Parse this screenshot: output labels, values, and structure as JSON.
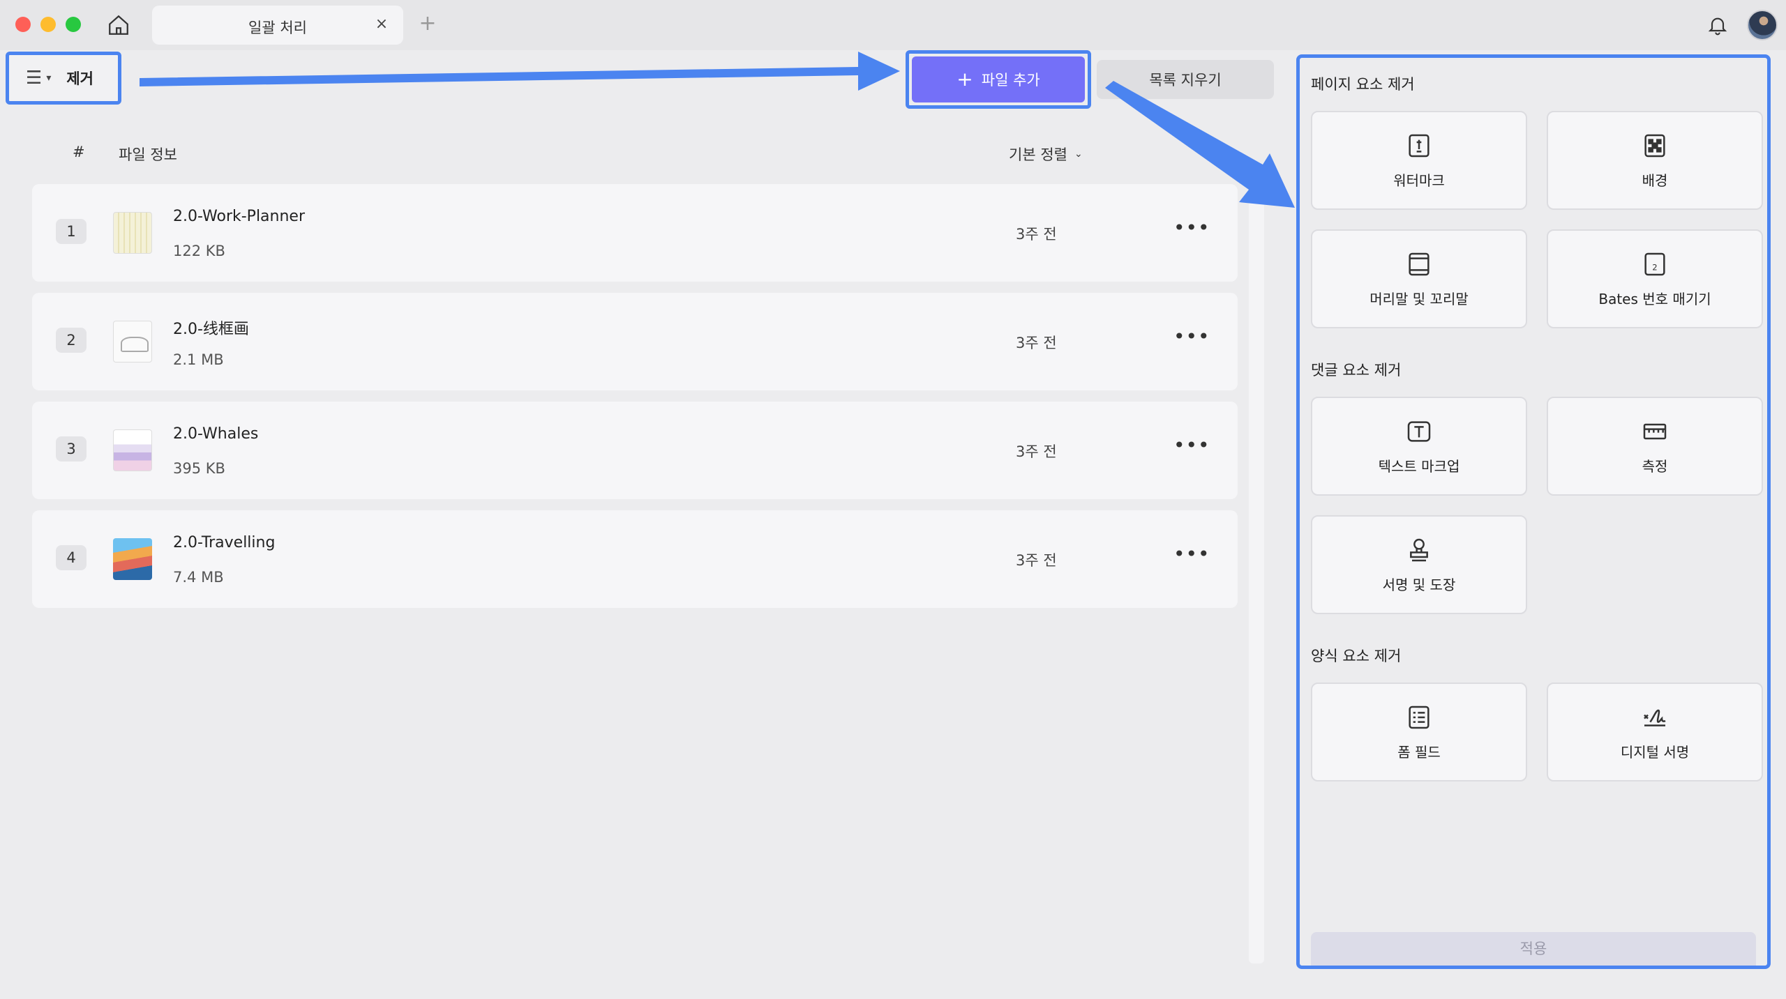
{
  "titlebar": {
    "tab_title": "일괄 처리",
    "tab_close": "×",
    "tab_add": "+"
  },
  "toolbar": {
    "mode_label": "제거",
    "add_file_label": "파일 추가",
    "add_file_plus": "+",
    "clear_list_label": "목록 지우기"
  },
  "list_header": {
    "hash": "#",
    "file_info": "파일 정보",
    "sort_label": "기본 정렬"
  },
  "files": [
    {
      "index": "1",
      "name": "2.0-Work-Planner",
      "size": "122 KB",
      "time": "3주 전",
      "thumb": "planner"
    },
    {
      "index": "2",
      "name": "2.0-线框画",
      "size": "2.1 MB",
      "time": "3주 전",
      "thumb": "sketch"
    },
    {
      "index": "3",
      "name": "2.0-Whales",
      "size": "395 KB",
      "time": "3주 전",
      "thumb": "whales"
    },
    {
      "index": "4",
      "name": "2.0-Travelling",
      "size": "7.4 MB",
      "time": "3주 전",
      "thumb": "travel"
    }
  ],
  "more_label": "•••",
  "panel": {
    "section_page": "페이지 요소 제거",
    "section_comment": "댓글 요소 제거",
    "section_form": "양식 요소 제거",
    "tools": {
      "watermark": "워터마크",
      "background": "배경",
      "header_footer": "머리말 및 꼬리말",
      "bates": "Bates 번호 매기기",
      "text_markup": "텍스트 마크업",
      "measure": "측정",
      "signature_stamp": "서명 및 도장",
      "form_field": "폼 필드",
      "digital_signature": "디지털 서명"
    },
    "apply_label": "적용"
  },
  "colors": {
    "accent": "#7470f8",
    "highlight": "#4b84f0"
  }
}
